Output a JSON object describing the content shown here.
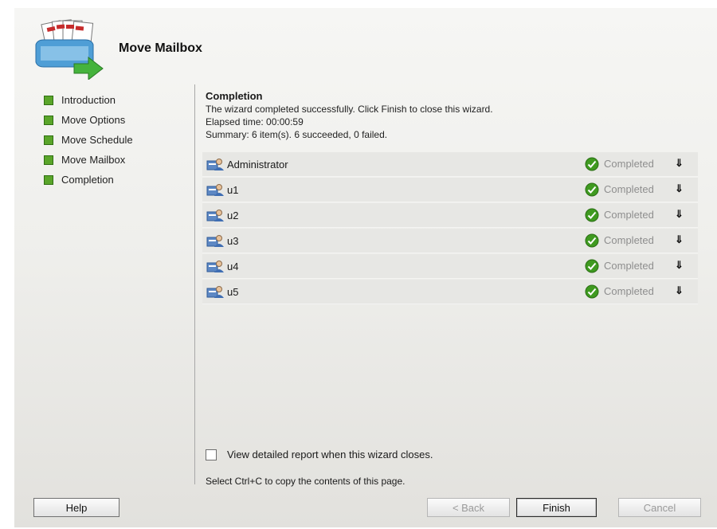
{
  "wizard": {
    "title": "Move Mailbox"
  },
  "steps": [
    "Introduction",
    "Move Options",
    "Move Schedule",
    "Move Mailbox",
    "Completion"
  ],
  "completion": {
    "heading": "Completion",
    "message": "The wizard completed successfully. Click Finish to close this wizard.",
    "elapsed": "Elapsed time: 00:00:59",
    "summary": "Summary: 6 item(s). 6 succeeded, 0 failed."
  },
  "results": [
    {
      "name": "Administrator",
      "status": "Completed"
    },
    {
      "name": "u1",
      "status": "Completed"
    },
    {
      "name": "u2",
      "status": "Completed"
    },
    {
      "name": "u3",
      "status": "Completed"
    },
    {
      "name": "u4",
      "status": "Completed"
    },
    {
      "name": "u5",
      "status": "Completed"
    }
  ],
  "options": {
    "view_report_label": "View detailed report when this wizard closes.",
    "view_report_checked": false,
    "copy_hint": "Select Ctrl+C to copy the contents of this page."
  },
  "buttons": {
    "help": "Help",
    "back": "< Back",
    "finish": "Finish",
    "cancel": "Cancel"
  },
  "colors": {
    "step_marker": "#5aa52a",
    "status_ok": "#3f9a20"
  }
}
